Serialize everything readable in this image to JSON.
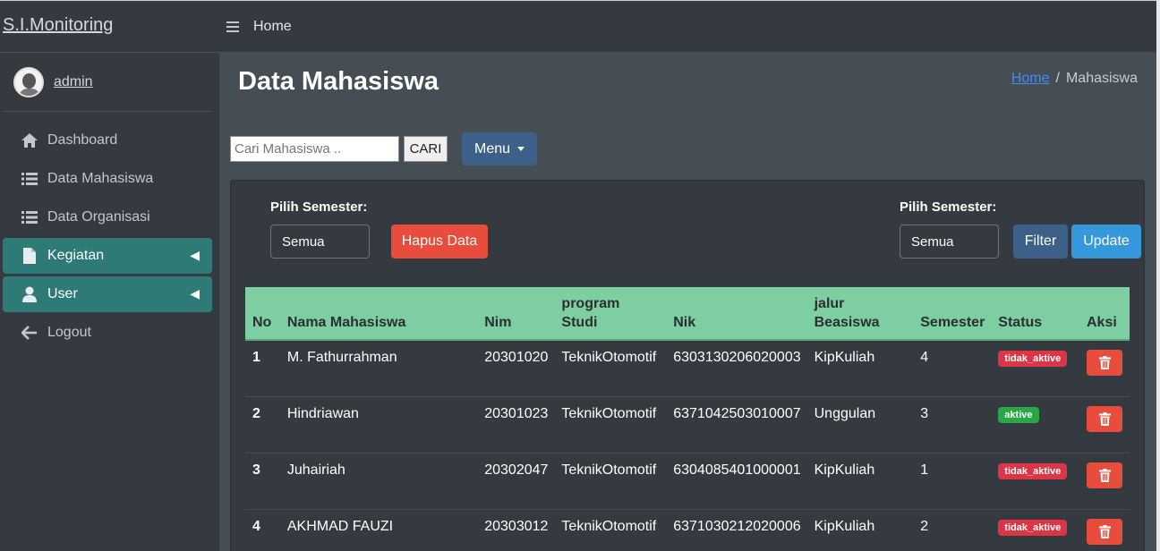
{
  "brand": "S.I.Monitoring",
  "user": {
    "name": "admin"
  },
  "sidebar": {
    "items": [
      {
        "label": "Dashboard",
        "icon": "home-icon",
        "active": false
      },
      {
        "label": "Data Mahasiswa",
        "icon": "list-icon",
        "active": false
      },
      {
        "label": "Data Organisasi",
        "icon": "list-icon",
        "active": false
      },
      {
        "label": "Kegiatan",
        "icon": "file-icon",
        "active": true
      },
      {
        "label": "User",
        "icon": "user-icon",
        "active": true
      },
      {
        "label": "Logout",
        "icon": "arrow-left-icon",
        "active": false
      }
    ]
  },
  "topbar": {
    "home": "Home"
  },
  "header": {
    "title": "Data Mahasiswa",
    "breadcrumb": {
      "home": "Home",
      "separator": "/",
      "current": "Mahasiswa"
    }
  },
  "search": {
    "placeholder": "Cari Mahasiswa ..",
    "button": "CARI"
  },
  "menu_button": "Menu",
  "filters": {
    "left_label": "Pilih Semester:",
    "left_value": "Semua",
    "delete_button": "Hapus Data",
    "right_label": "Pilih Semester:",
    "right_value": "Semua",
    "filter_button": "Filter",
    "update_button": "Update"
  },
  "table": {
    "headers": [
      "No",
      "Nama Mahasiswa",
      "Nim",
      "program Studi",
      "Nik",
      "jalur Beasiswa",
      "Semester",
      "Status",
      "Aksi"
    ],
    "rows": [
      {
        "no": "1",
        "nama": "M. Fathurrahman",
        "nim": "20301020",
        "prodi": "TeknikOtomotif",
        "nik": "6303130206020003",
        "jalur": "KipKuliah",
        "semester": "4",
        "status": "tidak_aktive"
      },
      {
        "no": "2",
        "nama": "Hindriawan",
        "nim": "20301023",
        "prodi": "TeknikOtomotif",
        "nik": "6371042503010007",
        "jalur": "Unggulan",
        "semester": "3",
        "status": "aktive"
      },
      {
        "no": "3",
        "nama": "Juhairiah",
        "nim": "20302047",
        "prodi": "TeknikOtomotif",
        "nik": "6304085401000001",
        "jalur": "KipKuliah",
        "semester": "1",
        "status": "tidak_aktive"
      },
      {
        "no": "4",
        "nama": "AKHMAD FAUZI",
        "nim": "20303012",
        "prodi": "TeknikOtomotif",
        "nik": "6371030212020006",
        "jalur": "KipKuliah",
        "semester": "2",
        "status": "tidak_aktive"
      }
    ]
  },
  "colors": {
    "sidebar_bg": "#343a40",
    "content_bg": "#454d55",
    "active_nav": "#2d7a77",
    "table_header": "#7dcea0",
    "danger": "#e74c3c",
    "primary": "#3c6088",
    "info": "#3498db",
    "badge_active": "#28a745",
    "badge_inactive": "#dc3545"
  }
}
